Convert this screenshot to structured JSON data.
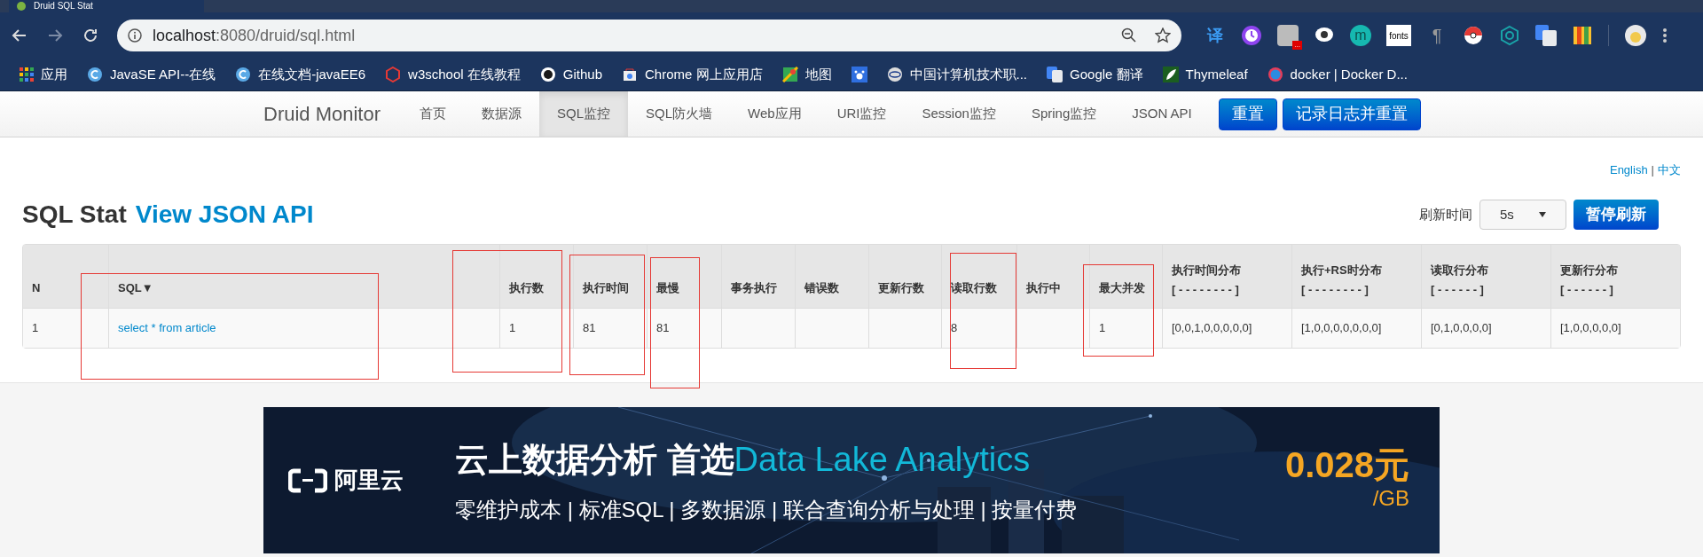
{
  "browser": {
    "tab_title": "Druid SQL Stat",
    "url_host": "localhost",
    "url_rest": ":8080/druid/sql.html",
    "bookmarks": [
      {
        "label": "应用",
        "kind": "apps"
      },
      {
        "label": "JavaSE API--在线",
        "kind": "c"
      },
      {
        "label": "在线文档-javaEE6",
        "kind": "c"
      },
      {
        "label": "w3school 在线教程",
        "kind": "w3"
      },
      {
        "label": "Github",
        "kind": "github"
      },
      {
        "label": "Chrome 网上应用店",
        "kind": "store"
      },
      {
        "label": "地图",
        "kind": "maps"
      },
      {
        "kind": "baidu"
      },
      {
        "label": "中国计算机技术职...",
        "kind": "globe"
      },
      {
        "label": "Google 翻译",
        "kind": "translate"
      },
      {
        "label": "Thymeleaf",
        "kind": "leaf"
      },
      {
        "label": "docker | Docker D...",
        "kind": "docker"
      }
    ],
    "extensions": [
      {
        "kind": "translate",
        "text": "译"
      },
      {
        "kind": "clock"
      },
      {
        "kind": "badge",
        "text": "..."
      },
      {
        "kind": "chat"
      },
      {
        "kind": "m",
        "text": "m"
      },
      {
        "kind": "fonts",
        "text": "fonts"
      },
      {
        "kind": "pilcrow",
        "text": "¶"
      },
      {
        "kind": "ball"
      },
      {
        "kind": "web"
      },
      {
        "kind": "gtrans"
      },
      {
        "kind": "ruler"
      }
    ]
  },
  "nav": {
    "brand": "Druid Monitor",
    "items": [
      {
        "label": "首页",
        "selected": false
      },
      {
        "label": "数据源",
        "selected": false
      },
      {
        "label": "SQL监控",
        "selected": true
      },
      {
        "label": "SQL防火墙",
        "selected": false
      },
      {
        "label": "Web应用",
        "selected": false
      },
      {
        "label": "URI监控",
        "selected": false
      },
      {
        "label": "Session监控",
        "selected": false
      },
      {
        "label": "Spring监控",
        "selected": false
      },
      {
        "label": "JSON API",
        "selected": false
      }
    ],
    "buttons": [
      "重置",
      "记录日志并重置"
    ]
  },
  "languages": [
    "English",
    "中文"
  ],
  "language_separator": "|",
  "title": "SQL Stat",
  "title_link": "View JSON API",
  "refresh": {
    "label": "刷新时间",
    "value": "5s",
    "button": "暂停刷新"
  },
  "table": {
    "columns": [
      {
        "label": "N"
      },
      {
        "label": "SQL▼"
      },
      {
        "label": "执行数"
      },
      {
        "label": "执行时间"
      },
      {
        "label": "最慢"
      },
      {
        "label": "事务执行"
      },
      {
        "label": "错误数"
      },
      {
        "label": "更新行数"
      },
      {
        "label": "读取行数"
      },
      {
        "label": "执行中"
      },
      {
        "label": "最大并发"
      },
      {
        "label": "执行时间分布",
        "sub": "[ - - - - - - - - ]"
      },
      {
        "label": "执行+RS时分布",
        "sub": "[ - - - - - - - - ]"
      },
      {
        "label": "读取行分布",
        "sub": "[ - - - - - - ]"
      },
      {
        "label": "更新行分布",
        "sub": "[ - - - - - - ]"
      }
    ],
    "rows": [
      [
        "1",
        "select * from article",
        "1",
        "81",
        "81",
        "",
        "",
        "",
        "8",
        "",
        "1",
        "[0,0,1,0,0,0,0,0]",
        "[1,0,0,0,0,0,0,0]",
        "[0,1,0,0,0,0]",
        "[1,0,0,0,0,0]"
      ]
    ]
  },
  "banner": {
    "logo": "阿里云",
    "headline": "云上数据分析 首选",
    "headline_accent": "Data Lake Analytics",
    "subline": "零维护成本 | 标准SQL | 多数据源 | 联合查询分析与处理 | 按量付费",
    "price": "0.028元",
    "unit": "/GB"
  }
}
